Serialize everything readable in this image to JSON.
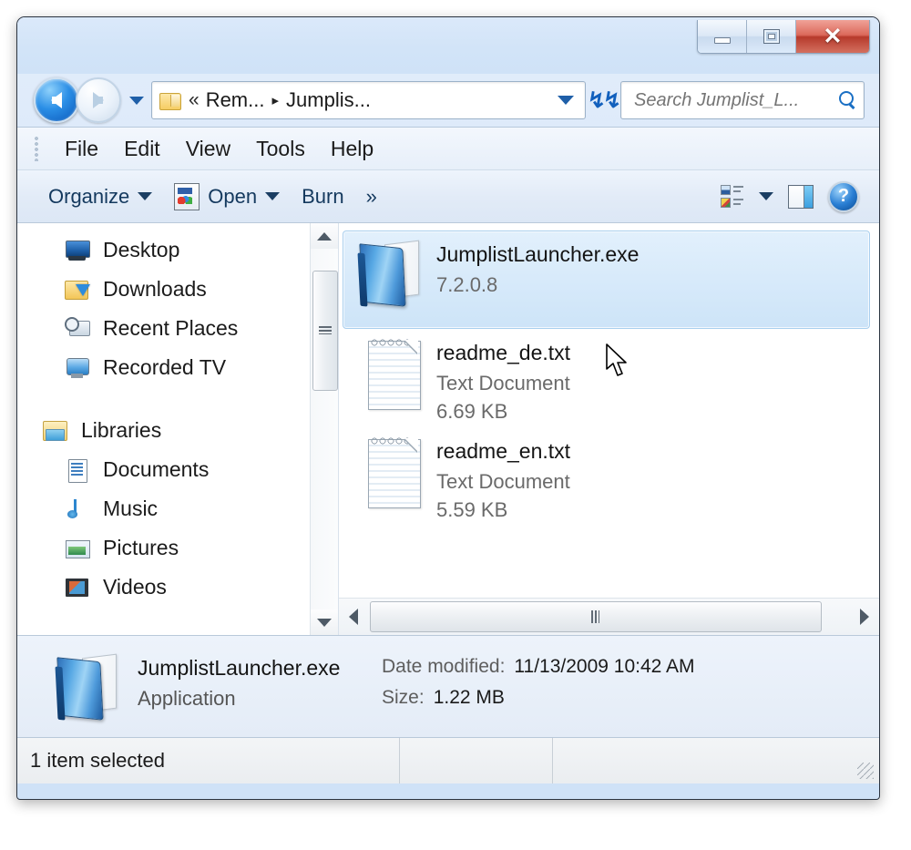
{
  "window": {
    "controls": {
      "minimize": "minimize-button",
      "restore": "restore-button",
      "close": "close-button"
    }
  },
  "navigation": {
    "back_label": "Back",
    "forward_label": "Forward",
    "history_label": "Recent pages"
  },
  "address": {
    "folder_icon": "folder-icon",
    "chevrons": "«",
    "crumb1": "Rem...",
    "separator": "▸",
    "crumb2": "Jumplis...",
    "dropdown": "chevron-down-icon",
    "refresh": "↻"
  },
  "search": {
    "placeholder": "Search Jumplist_L...",
    "value": "",
    "icon": "search-icon"
  },
  "menubar": {
    "items": [
      {
        "label": "File"
      },
      {
        "label": "Edit"
      },
      {
        "label": "View"
      },
      {
        "label": "Tools"
      },
      {
        "label": "Help"
      }
    ]
  },
  "toolbar": {
    "organize_label": "Organize",
    "open_label": "Open",
    "burn_label": "Burn",
    "overflow_label": "»",
    "view_icon": "change-view-icon",
    "preview_icon": "preview-pane-icon",
    "help_icon": "help-icon",
    "help_glyph": "?"
  },
  "sidebar": {
    "favorites": [
      {
        "label": "Desktop",
        "icon": "desktop-icon"
      },
      {
        "label": "Downloads",
        "icon": "downloads-folder-icon"
      },
      {
        "label": "Recent Places",
        "icon": "recent-places-icon"
      },
      {
        "label": "Recorded TV",
        "icon": "recorded-tv-icon"
      }
    ],
    "libraries_root": {
      "label": "Libraries",
      "icon": "libraries-icon"
    },
    "libraries": [
      {
        "label": "Documents",
        "icon": "documents-icon"
      },
      {
        "label": "Music",
        "icon": "music-icon"
      },
      {
        "label": "Pictures",
        "icon": "pictures-icon"
      },
      {
        "label": "Videos",
        "icon": "videos-icon"
      }
    ]
  },
  "files": [
    {
      "name": "JumplistLauncher.exe",
      "line2": "7.2.0.8",
      "line3": "",
      "icon": "application-book-icon",
      "selected": true
    },
    {
      "name": "readme_de.txt",
      "line2": "Text Document",
      "line3": "6.69 KB",
      "icon": "text-document-icon",
      "selected": false
    },
    {
      "name": "readme_en.txt",
      "line2": "Text Document",
      "line3": "5.59 KB",
      "icon": "text-document-icon",
      "selected": false
    }
  ],
  "details": {
    "icon": "application-book-icon",
    "name": "JumplistLauncher.exe",
    "type": "Application",
    "date_modified_label": "Date modified:",
    "date_modified_value": "11/13/2009 10:42 AM",
    "size_label": "Size:",
    "size_value": "1.22 MB"
  },
  "statusbar": {
    "selection_text": "1 item selected"
  },
  "colors": {
    "accent": "#2a7fd4",
    "selection": "#cde4f8",
    "titlebar": "#d2e4f8",
    "close_button": "#b63a2c"
  }
}
